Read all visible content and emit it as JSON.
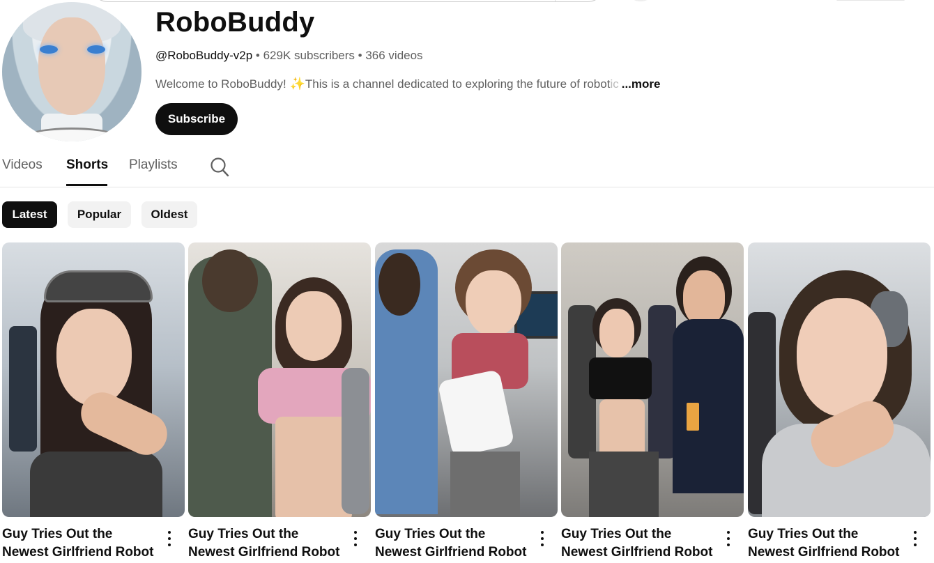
{
  "channel": {
    "name": "RoboBuddy",
    "handle": "@RoboBuddy-v2p",
    "subscribers": "629K subscribers",
    "videos": "366 videos",
    "separator": " • ",
    "description_start": "Welcome to RoboBuddy! ",
    "description_emoji": "✨",
    "description_rest": " This is a channel dedicated to exploring the future of robot",
    "description_fade": "ic",
    "more_label": "...more",
    "subscribe_label": "Subscribe"
  },
  "tabs": [
    {
      "label": "Videos",
      "active": false
    },
    {
      "label": "Shorts",
      "active": true
    },
    {
      "label": "Playlists",
      "active": false
    }
  ],
  "chips": [
    {
      "label": "Latest",
      "active": true
    },
    {
      "label": "Popular",
      "active": false
    },
    {
      "label": "Oldest",
      "active": false
    }
  ],
  "shorts": [
    {
      "title_line1": "Guy Tries Out the",
      "title_line2": "Newest Girlfriend Robot"
    },
    {
      "title_line1": "Guy Tries Out the",
      "title_line2": "Newest Girlfriend Robot"
    },
    {
      "title_line1": "Guy Tries Out the",
      "title_line2": "Newest Girlfriend Robot"
    },
    {
      "title_line1": "Guy Tries Out the",
      "title_line2": "Newest Girlfriend Robot"
    },
    {
      "title_line1": "Guy Tries Out the",
      "title_line2": "Newest Girlfriend Robot"
    }
  ],
  "icons": {
    "search": "search-icon",
    "more": "more-vert-icon"
  },
  "colors": {
    "primary_text": "#0f0f0f",
    "secondary_text": "#606060",
    "chip_bg": "#f2f2f2",
    "active_bg": "#0f0f0f"
  }
}
